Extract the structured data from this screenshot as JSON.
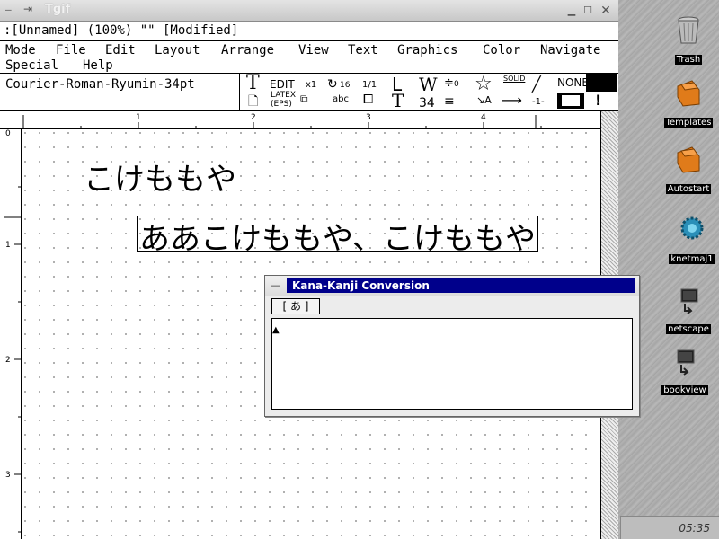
{
  "window": {
    "title": "Tgif",
    "status": ":[Unnamed] (100%) \"\" [Modified]"
  },
  "menu": {
    "items": [
      "Mode",
      "File",
      "Edit",
      "Layout",
      "Arrange",
      "View",
      "Text",
      "Graphics",
      "Color",
      "Navigate",
      "Special",
      "Help"
    ]
  },
  "toolbar": {
    "font": "Courier-Roman-Ryumin-34pt",
    "edit": "EDIT",
    "x1": "x1",
    "grid": "16",
    "page": "1/1",
    "latex": "LATEX",
    "eps": "(EPS)",
    "abc": "abc",
    "w": "W",
    "size": "34",
    "zero": "0",
    "solid": "SOLID",
    "none": "NONE",
    "minus1": "-1-",
    "star": "☆"
  },
  "rulers": {
    "top": [
      "1",
      "2",
      "3",
      "4"
    ],
    "left": [
      "0",
      "1",
      "2",
      "3"
    ]
  },
  "canvas": {
    "text_1": "こけももや",
    "text_2": "ああこけももや、こけももや"
  },
  "dialog": {
    "title": "Kana-Kanji Conversion",
    "mode": "[ あ ]",
    "caret": "▲"
  },
  "desktop": {
    "icons": [
      {
        "label": "Trash",
        "icon": "trash-icon"
      },
      {
        "label": "Templates",
        "icon": "folder-icon"
      },
      {
        "label": "Autostart",
        "icon": "folder-icon"
      },
      {
        "label": "knetmaj1",
        "icon": "gear-icon"
      },
      {
        "label": "netscape",
        "icon": "terminal-icon"
      },
      {
        "label": "bookview",
        "icon": "terminal-icon"
      }
    ],
    "clock": "05:35"
  },
  "colors": {
    "dialog_title_bg": "#00008b",
    "desktop_bg": "#a9a9a9",
    "folder": "#e07b1a"
  }
}
